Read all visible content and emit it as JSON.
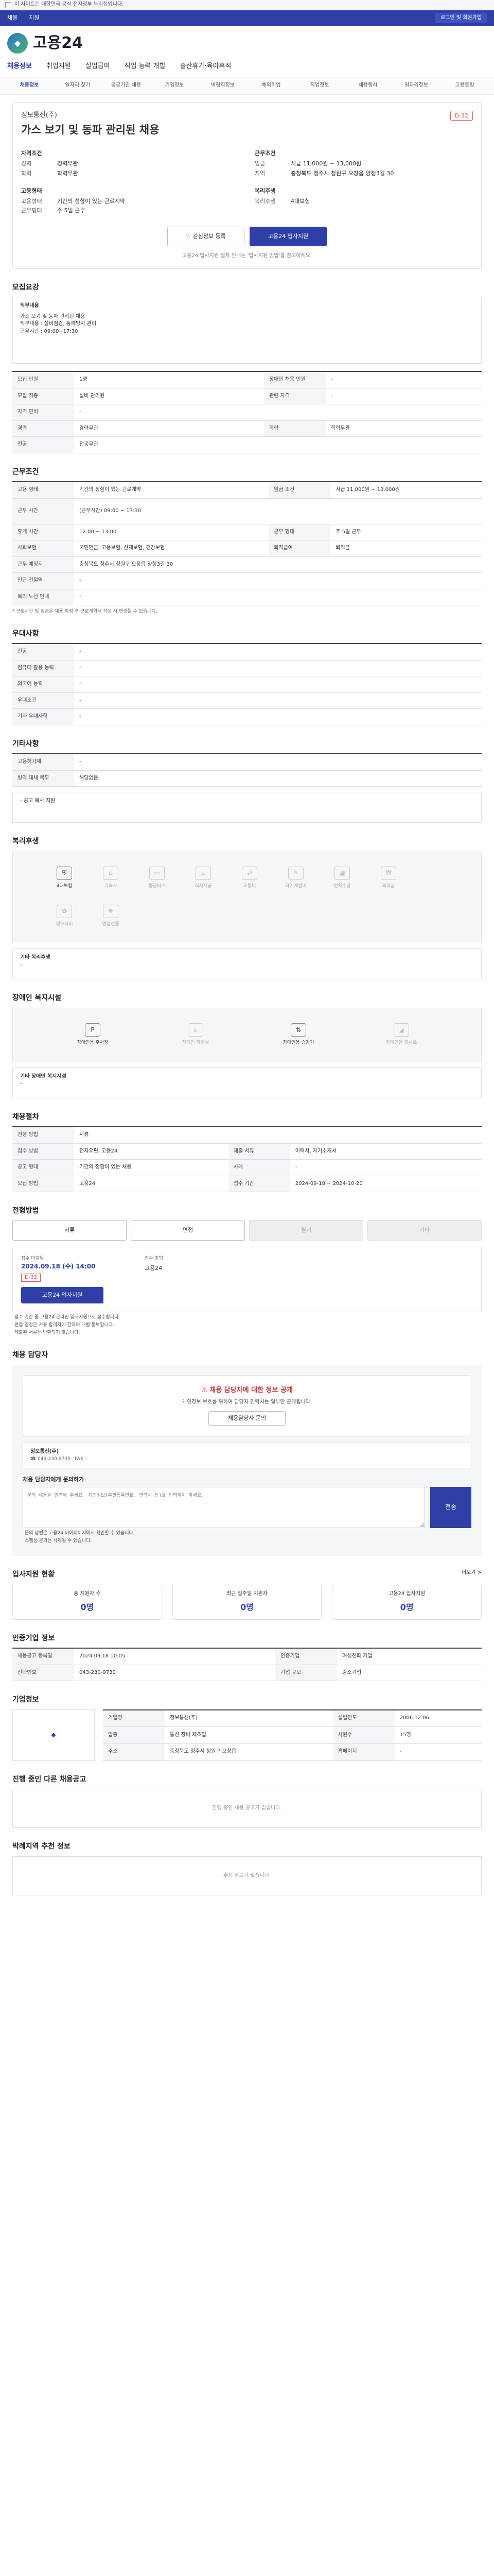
{
  "top": {
    "notice": "이 사이트는 대한민국 공식 전자정부 누리집입니다.",
    "links": [
      "채용",
      "지원"
    ],
    "right": "로그인 및 회원가입"
  },
  "brand": {
    "name": "고용24"
  },
  "gnb": [
    "채용정보",
    "취업지원",
    "실업급여",
    "직업 능력 개발",
    "출산휴가·육아휴직"
  ],
  "subgnb": [
    "채용정보",
    "일자리 찾기",
    "공공기관 채용",
    "기업정보",
    "박람회정보",
    "해외취업",
    "직업정보",
    "채용행사",
    "일자리정보",
    "고용동향"
  ],
  "job": {
    "org": "정보통신(주)",
    "title": "가스 보기 및 동파 관리된 채용",
    "dday": "D-32",
    "left_h": "자격조건",
    "left": [
      [
        "경력",
        "경력무관"
      ],
      [
        "학력",
        "학력무관"
      ]
    ],
    "right_h": "근무조건",
    "right": [
      [
        "임금",
        "시급 11,000원 ~ 13,000원"
      ],
      [
        "지역",
        "충청북도 청주시 청원구 오창읍 양청3길 30"
      ]
    ],
    "left2_h": "고용형태",
    "left2": [
      [
        "고용형태",
        "기간의 정함이 있는 근로계약"
      ],
      [
        "근무형태",
        "주 5일 근무"
      ]
    ],
    "right2_h": "복리후생",
    "right2": [
      [
        "복리후생",
        "4대보험"
      ]
    ],
    "btn_like": "관심정보 등록",
    "btn_apply": "고용24 입사지원",
    "note": "고용24 입사지원 절차 안내는 '입사지원 방법'을 참고하세요."
  },
  "s1": {
    "title": "모집요강",
    "box_h": "직무내용",
    "box": [
      "가스 보기 및 동파 관리된 채용",
      "직무내용 : 설비점검, 동파방지 관리",
      "근무시간 : 09:00~17:30"
    ],
    "rows": [
      [
        "모집 인원",
        "1명",
        "장애인 채용 인원",
        "-"
      ],
      [
        "모집 직종",
        "설비 관리원",
        "관련 자격",
        "-"
      ],
      [
        "자격 면허",
        "-",
        "",
        ""
      ],
      [
        "경력",
        "경력무관",
        "학력",
        "학력무관"
      ],
      [
        "전공",
        "전공무관",
        "",
        ""
      ]
    ]
  },
  "s2": {
    "title": "근무조건",
    "rows": [
      [
        "고용 형태",
        "기간의 정함이 있는 근로계약",
        "임금 조건",
        "시급 11,000원 ~ 13,000원"
      ],
      [
        "근무 시간",
        "(근무시간) 09:00 ~ 17:30",
        "",
        ""
      ],
      [
        "휴게 시간",
        "12:00 ~ 13:00",
        "근무 형태",
        "주 5일 근무"
      ],
      [
        "사회보험",
        "국민연금, 고용보험, 산재보험, 건강보험",
        "퇴직급여",
        "퇴직금"
      ],
      [
        "근무 예정지",
        "충청북도 청주시 청원구 오창읍 양청3길 30",
        "",
        ""
      ],
      [
        "인근 전철역",
        "-",
        "",
        ""
      ],
      [
        "복리 노선 안내",
        "-",
        "",
        ""
      ]
    ],
    "note": "* 근로시간 및 임금은 채용 확정 후 근로계약서 작성 시 변경될 수 있습니다."
  },
  "s3": {
    "title": "우대사항",
    "rows": [
      [
        "전공",
        "-"
      ],
      [
        "컴퓨터 활용 능력",
        "-"
      ],
      [
        "외국어 능력",
        "-"
      ],
      [
        "우대조건",
        "-"
      ],
      [
        "기타 우대사항",
        "-"
      ]
    ]
  },
  "s4": {
    "title": "기타사항",
    "rows": [
      [
        "고용허가제",
        "-"
      ],
      [
        "병역 대체 복무",
        "해당없음"
      ]
    ],
    "box": "- 공고 복사 지원"
  },
  "s5": {
    "title": "복리후생",
    "icons": [
      "4대보험",
      "기숙사",
      "통근버스",
      "식사제공",
      "교통비",
      "자기계발비",
      "연차수당",
      "퇴직금",
      "경조사비",
      "명절선물"
    ],
    "box_h": "기타 복리후생",
    "box": "-"
  },
  "s6": {
    "title": "장애인 복지시설",
    "icons": [
      "장애인용 주차장",
      "장애인 화장실",
      "장애인용 승강기",
      "장애인용 경사로"
    ],
    "box_h": "기타 장애인 복지시설",
    "box": "-"
  },
  "s7": {
    "title": "채용절차",
    "rows": [
      [
        "전형 방법",
        "서류",
        "",
        ""
      ],
      [
        "접수 방법",
        "전자우편, 고용24",
        "제출 서류",
        "이력서, 자기소개서"
      ],
      [
        "공고 형태",
        "기간의 정함이 있는 채용",
        "사례",
        "-"
      ],
      [
        "모집 방법",
        "고용24",
        "접수 기간",
        "2024-09-18 ~ 2024-10-20"
      ]
    ]
  },
  "s8": {
    "title": "전형방법",
    "tabs": [
      "서류",
      "면접",
      "필기",
      "기타"
    ],
    "start_label": "접수 마감일",
    "start": "2024.09.18 (수) 14:00",
    "dtag": "D-32",
    "end_label": "접수 방법",
    "end": "고용24",
    "apply": "고용24 입사지원",
    "list": [
      "접수 기간 중 고용24 온라인 입사지원으로 접수합니다.",
      "면접 일정은 서류 합격자에 한하여 개별 통보합니다.",
      "제출된 서류는 반환되지 않습니다."
    ]
  },
  "s9": {
    "title": "채용 담당자",
    "alert_t": "채용 담당자에 대한 정보 공개",
    "alert_b": "개인정보 보호를 위하여 담당자 연락처는 일부만 공개됩니다.",
    "alert_btn": "채용담당자 문의",
    "company": "정보통신(주)",
    "tel": "043-230-9730",
    "fax": "-",
    "ta_h": "채용 담당자에게 문의하기",
    "ta_ph": "문의 내용을 입력해 주세요. 개인정보(주민등록번호, 연락처 등)를 입력하지 마세요.",
    "send": "전송",
    "list": [
      "문의 답변은 고용24 마이페이지에서 확인할 수 있습니다.",
      "스팸성 문의는 삭제될 수 있습니다."
    ]
  },
  "s10": {
    "title": "입사지원 현황",
    "more": "더보기 >",
    "stats": [
      [
        "총 지원자 수",
        "0명"
      ],
      [
        "최근 일주일 지원자",
        "0명"
      ],
      [
        "고용24 입사지원",
        "0명"
      ]
    ]
  },
  "s11": {
    "title": "인증기업 정보",
    "rows": [
      [
        "채용공고 등록일",
        "2024.09.18 10:05",
        "인증기업",
        "여성친화 기업"
      ],
      [
        "전화번호",
        "043-230-9730",
        "기업 규모",
        "중소기업"
      ]
    ]
  },
  "s12": {
    "title": "기업정보",
    "rows": [
      [
        "기업명",
        "정보통신(주)",
        "설립연도",
        "2006.12.06"
      ],
      [
        "업종",
        "통신 장비 제조업",
        "사원수",
        "15명"
      ],
      [
        "주소",
        "충청북도 청주시 청원구 오창읍",
        "홈페이지",
        "-"
      ]
    ]
  },
  "s13": {
    "title": "진행 중인 다른 채용공고",
    "empty": "진행 중인 채용 공고가 없습니다."
  },
  "s14": {
    "title": "박례지역 추천 정보",
    "empty": "추천 정보가 없습니다."
  }
}
